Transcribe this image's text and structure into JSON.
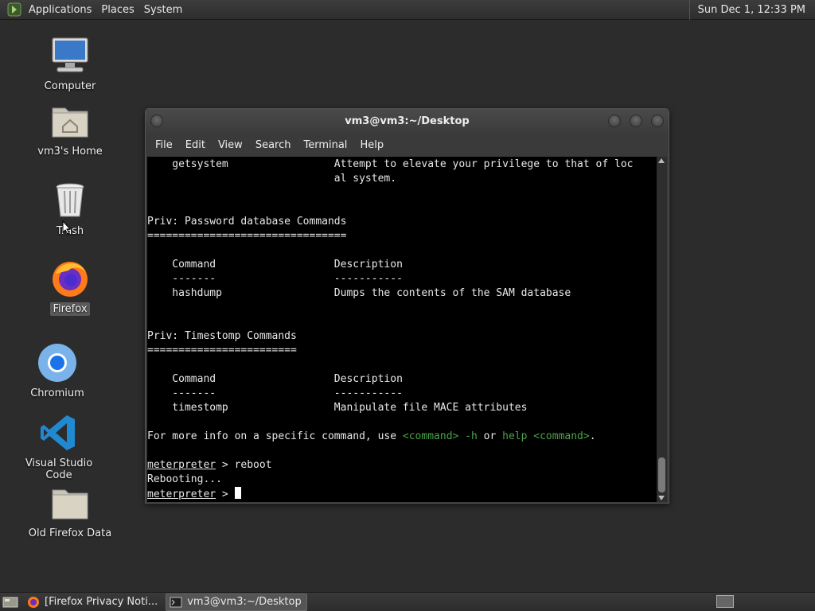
{
  "top_panel": {
    "menus": [
      "Applications",
      "Places",
      "System"
    ],
    "clock": "Sun Dec  1, 12:33 PM"
  },
  "desktop": {
    "icons": [
      {
        "label": "Computer",
        "icon": "computer-icon"
      },
      {
        "label": "vm3's Home",
        "icon": "home-folder-icon"
      },
      {
        "label": "Trash",
        "icon": "trash-icon"
      },
      {
        "label": "Firefox",
        "icon": "firefox-icon"
      },
      {
        "label": "Chromium",
        "icon": "chromium-icon"
      },
      {
        "label": "Visual Studio Code",
        "icon": "vscode-icon"
      },
      {
        "label": "Old Firefox Data",
        "icon": "folder-icon"
      }
    ]
  },
  "terminal": {
    "title": "vm3@vm3:~/Desktop",
    "menu": [
      "File",
      "Edit",
      "View",
      "Search",
      "Terminal",
      "Help"
    ],
    "lines": [
      "    getsystem                 Attempt to elevate your privilege to that of loc",
      "                              al system.",
      "",
      "",
      "Priv: Password database Commands",
      "================================",
      "",
      "    Command                   Description",
      "    -------                   -----------",
      "    hashdump                  Dumps the contents of the SAM database",
      "",
      "",
      "Priv: Timestomp Commands",
      "========================",
      "",
      "    Command                   Description",
      "    -------                   -----------",
      "    timestomp                 Manipulate file MACE attributes",
      "",
      "For more info on a specific command, use <command> -h or help <command>.",
      "",
      "meterpreter > reboot",
      "Rebooting...",
      "meterpreter > "
    ],
    "info_parts": [
      "For more info on a specific command, use ",
      "<command> -h",
      " or ",
      "help <command>",
      "."
    ],
    "prompt": "meterpreter",
    "prompt_suffix": " > ",
    "reboot_cmd": "reboot",
    "rebooting": "Rebooting..."
  },
  "taskbar": {
    "tasks": [
      {
        "label": "[Firefox Privacy Noti...",
        "icon": "firefox-icon"
      },
      {
        "label": "vm3@vm3:~/Desktop",
        "icon": "terminal-icon"
      }
    ]
  },
  "colors": {
    "desktop_bg": "#2c2c2c",
    "terminal_bg": "#000000",
    "terminal_green": "#4aa34a"
  }
}
